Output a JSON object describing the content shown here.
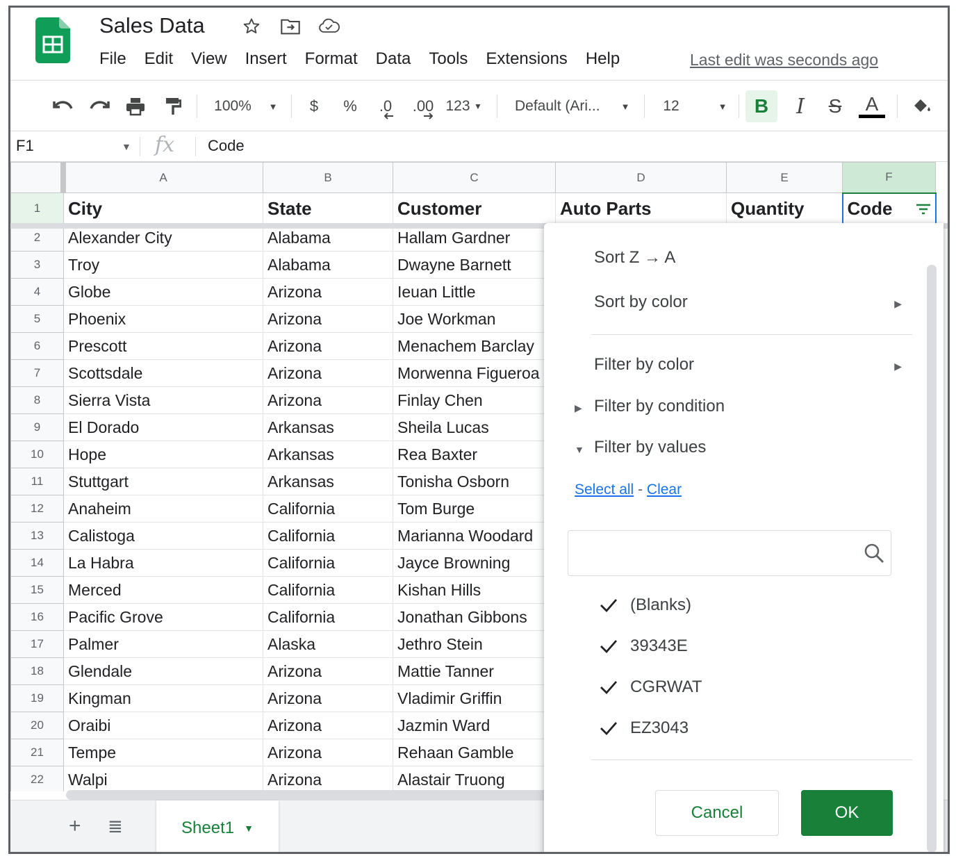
{
  "app": {
    "title": "Sales Data",
    "menu": [
      "File",
      "Edit",
      "View",
      "Insert",
      "Format",
      "Data",
      "Tools",
      "Extensions",
      "Help"
    ],
    "last_edit": "Last edit was seconds ago"
  },
  "toolbar": {
    "zoom": "100%",
    "currency": "$",
    "percent": "%",
    "decrease_decimal": ".0",
    "increase_decimal": ".00",
    "more_formats": "123",
    "font": "Default (Ari...",
    "font_size": "12",
    "bold": "B",
    "italic": "I",
    "strike": "S",
    "text_color": "A"
  },
  "formula_bar": {
    "cell_ref": "F1",
    "fx": "fx",
    "content": "Code"
  },
  "sheet": {
    "columns": [
      "A",
      "B",
      "C",
      "D",
      "E",
      "F"
    ],
    "selected_column": "F",
    "headers": [
      "City",
      "State",
      "Customer",
      "Auto Parts",
      "Quantity",
      "Code"
    ],
    "rows": [
      {
        "n": "2",
        "city": "Alexander City",
        "state": "Alabama",
        "customer": "Hallam Gardner"
      },
      {
        "n": "3",
        "city": "Troy",
        "state": "Alabama",
        "customer": "Dwayne Barnett"
      },
      {
        "n": "4",
        "city": "Globe",
        "state": "Arizona",
        "customer": "Ieuan Little"
      },
      {
        "n": "5",
        "city": "Phoenix",
        "state": "Arizona",
        "customer": "Joe Workman"
      },
      {
        "n": "6",
        "city": "Prescott",
        "state": "Arizona",
        "customer": "Menachem Barclay"
      },
      {
        "n": "7",
        "city": "Scottsdale",
        "state": "Arizona",
        "customer": "Morwenna Figueroa"
      },
      {
        "n": "8",
        "city": "Sierra Vista",
        "state": "Arizona",
        "customer": "Finlay Chen"
      },
      {
        "n": "9",
        "city": "El Dorado",
        "state": "Arkansas",
        "customer": "Sheila Lucas"
      },
      {
        "n": "10",
        "city": "Hope",
        "state": "Arkansas",
        "customer": "Rea Baxter"
      },
      {
        "n": "11",
        "city": "Stuttgart",
        "state": "Arkansas",
        "customer": "Tonisha Osborn"
      },
      {
        "n": "12",
        "city": "Anaheim",
        "state": "California",
        "customer": "Tom Burge"
      },
      {
        "n": "13",
        "city": "Calistoga",
        "state": "California",
        "customer": "Marianna Woodard"
      },
      {
        "n": "14",
        "city": "La Habra",
        "state": "California",
        "customer": "Jayce Browning"
      },
      {
        "n": "15",
        "city": "Merced",
        "state": "California",
        "customer": "Kishan Hills"
      },
      {
        "n": "16",
        "city": "Pacific Grove",
        "state": "California",
        "customer": "Jonathan Gibbons"
      },
      {
        "n": "17",
        "city": "Palmer",
        "state": "Alaska",
        "customer": "Jethro Stein"
      },
      {
        "n": "18",
        "city": "Glendale",
        "state": "Arizona",
        "customer": "Mattie Tanner"
      },
      {
        "n": "19",
        "city": "Kingman",
        "state": "Arizona",
        "customer": "Vladimir Griffin"
      },
      {
        "n": "20",
        "city": "Oraibi",
        "state": "Arizona",
        "customer": "Jazmin Ward"
      },
      {
        "n": "21",
        "city": "Tempe",
        "state": "Arizona",
        "customer": "Rehaan Gamble"
      },
      {
        "n": "22",
        "city": "Walpi",
        "state": "Arizona",
        "customer": "Alastair Truong"
      }
    ]
  },
  "filter_menu": {
    "sort_za": "Sort Z → A",
    "sort_by_color": "Sort by color",
    "filter_by_color": "Filter by color",
    "filter_by_condition": "Filter by condition",
    "filter_by_values": "Filter by values",
    "select_all": "Select all",
    "link_separator": "-",
    "clear": "Clear",
    "search_placeholder": "",
    "values": [
      "(Blanks)",
      "39343E",
      "CGRWAT",
      "EZ3043"
    ],
    "cancel": "Cancel",
    "ok": "OK"
  },
  "tabs": {
    "active": "Sheet1"
  },
  "colors": {
    "brand_green": "#188038",
    "link_blue": "#1a73e8",
    "selection_blue": "#1a73e8"
  }
}
